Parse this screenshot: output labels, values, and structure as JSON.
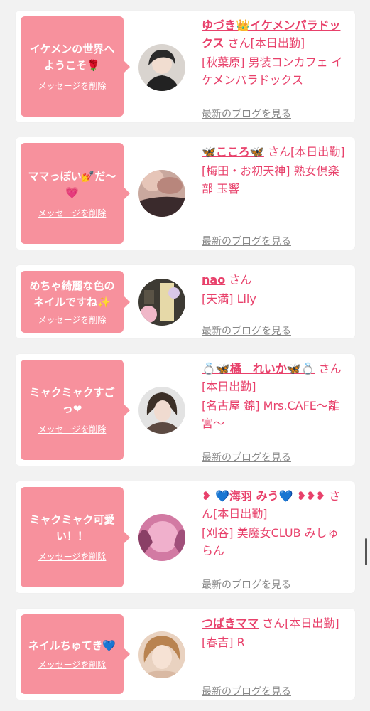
{
  "delete_label": "メッセージを削除",
  "blog_label": "最新のブログを見る",
  "entries": [
    {
      "message": "イケメンの世界へようこそ🌹",
      "name": "ゆづき👑イケメンパラドックス",
      "suffix": "さん[本日出勤]",
      "shop": "[秋葉原] 男装コンカフェ イケメンパラドックス"
    },
    {
      "message": "ママっぽい💅だ〜💗",
      "name": "🦋こころ🦋",
      "suffix": "さん[本日出勤]",
      "shop": "[梅田・お初天神] 熟女倶楽部 玉響"
    },
    {
      "message": "めちゃ綺麗な色のネイルですね✨",
      "name": "nao",
      "suffix": "さん",
      "shop": "[天満] Lily"
    },
    {
      "message": "ミャクミャクすごっ❤",
      "name": "💍🦋橘　れいか🦋💍",
      "suffix": "さん[本日出勤]",
      "shop": "[名古屋 錦] Mrs.CAFE〜離宮〜"
    },
    {
      "message": "ミャクミャク可愛い！！",
      "name": "❥ 💙海羽 みう💙 ❥❥❥",
      "suffix": "さん[本日出勤]",
      "shop": "[刈谷] 美魔女CLUB みしゅらん"
    },
    {
      "message": "ネイルちゅてき💙",
      "name": "つばきママ",
      "suffix": "さん[本日出勤]",
      "shop": "[春吉] R"
    }
  ]
}
